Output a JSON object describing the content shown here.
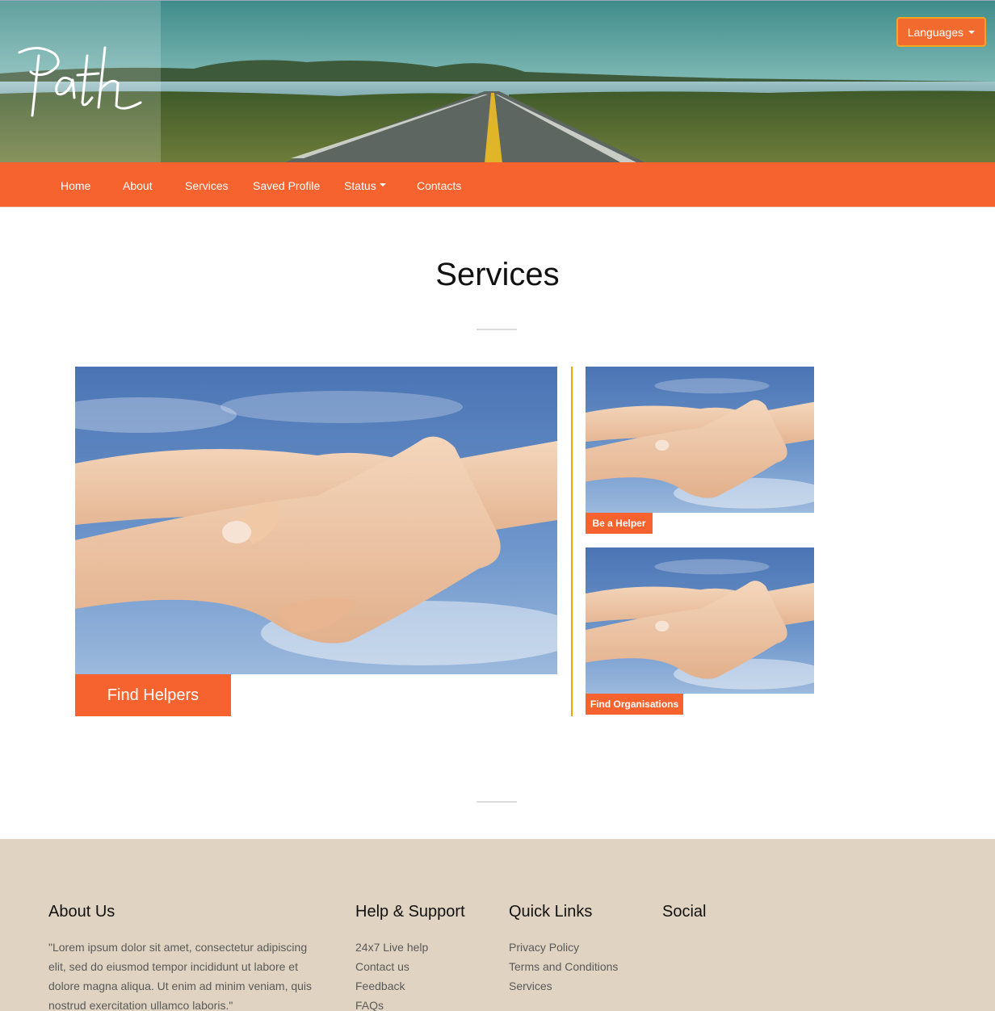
{
  "header": {
    "logo_text": "Path",
    "languages_label": "Languages"
  },
  "nav": {
    "items": [
      {
        "label": "Home"
      },
      {
        "label": "About"
      },
      {
        "label": "Services"
      },
      {
        "label": "Saved Profile"
      },
      {
        "label": "Status"
      },
      {
        "label": "Contacts"
      }
    ]
  },
  "main": {
    "title": "Services",
    "cards": [
      {
        "label": "Find Helpers"
      },
      {
        "label": "Be a Helper"
      },
      {
        "label": "Find Organisations"
      }
    ]
  },
  "footer": {
    "about": {
      "heading": "About Us",
      "text": "\"Lorem ipsum dolor sit amet, consectetur adipiscing elit, sed do eiusmod tempor incididunt ut labore et dolore magna aliqua. Ut enim ad minim veniam, quis nostrud exercitation ullamco laboris.\""
    },
    "help": {
      "heading": "Help & Support",
      "links": [
        "24x7 Live help",
        "Contact us",
        "Feedback",
        "FAQs"
      ]
    },
    "quick": {
      "heading": "Quick Links",
      "links": [
        "Privacy Policy",
        "Terms and Conditions",
        "Services"
      ]
    },
    "social": {
      "heading": "Social"
    }
  },
  "colors": {
    "accent": "#f7632e",
    "accent_border": "#f5a623",
    "divider_line": "#f0a500",
    "footer_bg": "#e0d3c1"
  },
  "icons": [
    "caret-down-icon"
  ]
}
